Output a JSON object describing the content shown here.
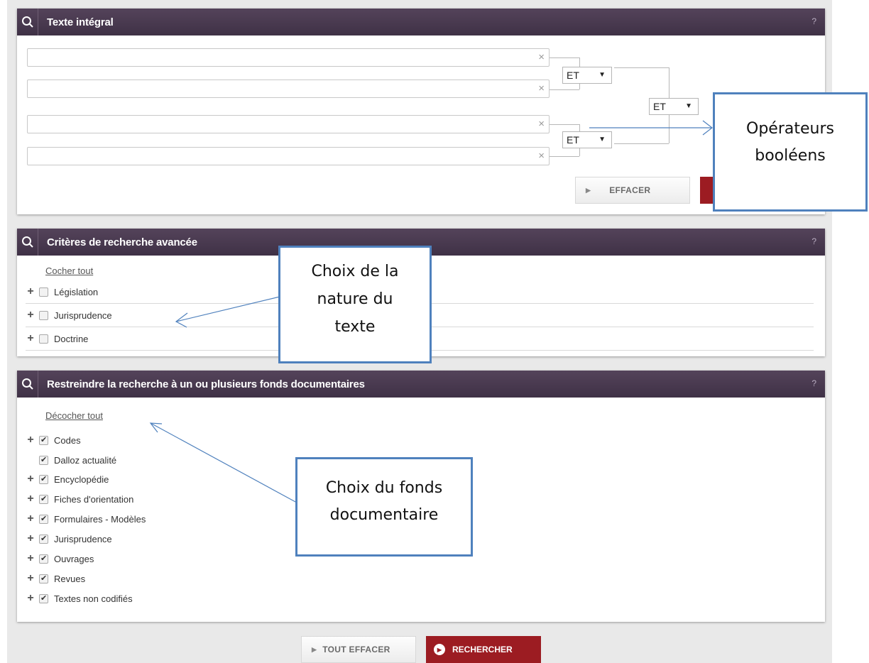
{
  "panels": {
    "texte": {
      "title": "Texte intégral",
      "help": "?"
    },
    "criteres": {
      "title": "Critères de recherche avancée",
      "help": "?"
    },
    "fonds": {
      "title": "Restreindre la recherche à un ou plusieurs fonds documentaires",
      "help": "?"
    }
  },
  "texte_integral": {
    "inputs": [
      "",
      "",
      "",
      ""
    ],
    "operators": {
      "op1": "ET",
      "op2": "ET",
      "op3": "ET"
    },
    "clear_label": "EFFACER"
  },
  "criteres": {
    "check_all": "Cocher tout",
    "items": [
      {
        "label": "Législation",
        "checked": false
      },
      {
        "label": "Jurisprudence",
        "checked": false
      },
      {
        "label": "Doctrine",
        "checked": false
      }
    ]
  },
  "fonds": {
    "uncheck_all": "Décocher tout",
    "items": [
      {
        "label": "Codes",
        "checked": true,
        "expandable": true
      },
      {
        "label": "Dalloz actualité",
        "checked": true,
        "expandable": false
      },
      {
        "label": "Encyclopédie",
        "checked": true,
        "expandable": true
      },
      {
        "label": "Fiches d'orientation",
        "checked": true,
        "expandable": true
      },
      {
        "label": "Formulaires - Modèles",
        "checked": true,
        "expandable": true
      },
      {
        "label": "Jurisprudence",
        "checked": true,
        "expandable": true
      },
      {
        "label": "Ouvrages",
        "checked": true,
        "expandable": true
      },
      {
        "label": "Revues",
        "checked": true,
        "expandable": true
      },
      {
        "label": "Textes non codifiés",
        "checked": true,
        "expandable": true
      }
    ]
  },
  "footer": {
    "clear_all": "TOUT EFFACER",
    "search": "RECHERCHER"
  },
  "callouts": {
    "operators": "Opérateurs booléens",
    "nature": "Choix de la nature du texte",
    "fonds": "Choix du fonds documentaire"
  },
  "colors": {
    "header": "#4a3a4a",
    "accent_red": "#9c1c22",
    "callout_border": "#4f81bd"
  }
}
